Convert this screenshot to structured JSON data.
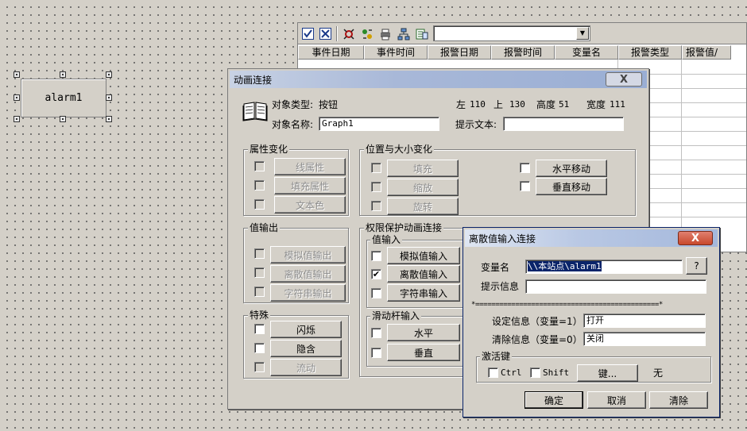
{
  "canvas": {
    "button_label": "alarm1"
  },
  "alarm_window": {
    "columns": [
      "事件日期",
      "事件时间",
      "报警日期",
      "报警时间",
      "变量名",
      "报警类型",
      "报警值/"
    ],
    "toolbar_icons": [
      "check-icon",
      "uncheck-icon",
      "filter-icon",
      "sort-icon",
      "print-icon",
      "network-icon",
      "export-icon"
    ],
    "combo_value": ""
  },
  "anim_dialog": {
    "title": "动画连接",
    "close_symbol": "X",
    "object_type_label": "对象类型:",
    "object_type_value": "按钮",
    "object_name_label": "对象名称:",
    "object_name_value": "Graph1",
    "left_label": "左",
    "left_value": "110",
    "top_label": "上",
    "top_value": "130",
    "height_label": "高度",
    "height_value": "51",
    "width_label": "宽度",
    "width_value": "111",
    "tip_label": "提示文本:",
    "tip_value": "",
    "groups": {
      "attr_change": {
        "title": "属性变化",
        "items": [
          {
            "label": "线属性",
            "checked": false
          },
          {
            "label": "填充属性",
            "checked": false
          },
          {
            "label": "文本色",
            "checked": false
          }
        ]
      },
      "pos_size": {
        "title": "位置与大小变化",
        "left_items": [
          {
            "label": "填充",
            "checked": false
          },
          {
            "label": "缩放",
            "checked": false
          },
          {
            "label": "旋转",
            "checked": false
          }
        ],
        "right_items": [
          {
            "label": "水平移动",
            "checked": false
          },
          {
            "label": "垂直移动",
            "checked": false
          }
        ]
      },
      "value_output": {
        "title": "值输出",
        "items": [
          {
            "label": "模拟值输出",
            "checked": false
          },
          {
            "label": "离散值输出",
            "checked": false
          },
          {
            "label": "字符串输出",
            "checked": false
          }
        ]
      },
      "perm": {
        "title": "权限保护动画连接",
        "input_title": "值输入",
        "input_items": [
          {
            "label": "模拟值输入",
            "checked": false
          },
          {
            "label": "离散值输入",
            "checked": true
          },
          {
            "label": "字符串输入",
            "checked": false
          }
        ],
        "slider_title": "滑动杆输入",
        "slider_items": [
          {
            "label": "水平",
            "checked": false
          },
          {
            "label": "垂直",
            "checked": false
          }
        ]
      },
      "special": {
        "title": "特殊",
        "items": [
          {
            "label": "闪烁",
            "checked": false
          },
          {
            "label": "隐含",
            "checked": false
          },
          {
            "label": "流动",
            "checked": false
          }
        ]
      }
    }
  },
  "discrete_dialog": {
    "title": "离散值输入连接",
    "close_symbol": "X",
    "var_label": "变量名",
    "var_value": "\\\\本站点\\alarm1",
    "browse_label": "?",
    "prompt_label": "提示信息",
    "prompt_value": "",
    "separator": "*==============================================*",
    "set_label": "设定信息（变量=1）",
    "set_value": "打开",
    "clear_label": "清除信息（变量=0）",
    "clear_value": "关闭",
    "hotkey_title": "激活键",
    "ctrl_label": "Ctrl",
    "shift_label": "Shift",
    "key_button": "键...",
    "key_value": "无",
    "ok_label": "确定",
    "cancel_label": "取消",
    "clear_btn_label": "清除"
  },
  "colors": {
    "title_active": "#0a246a",
    "title_inactive": "#a8b8d8",
    "close_red": "#c8482c"
  }
}
